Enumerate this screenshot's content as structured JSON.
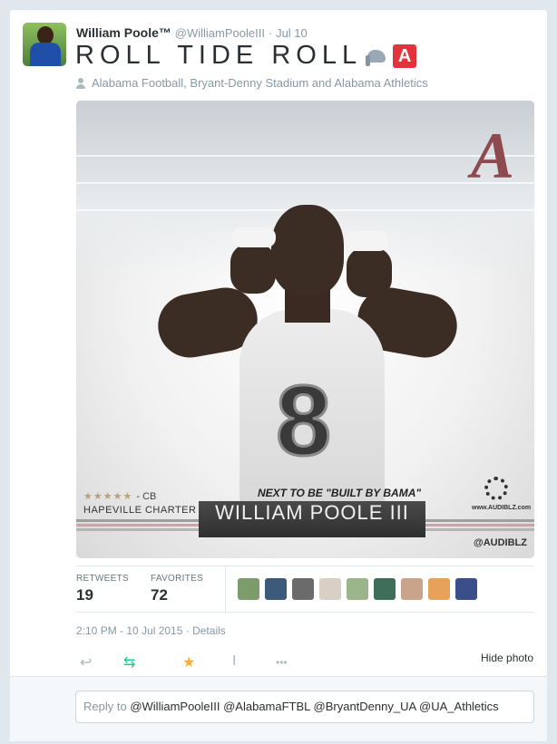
{
  "tweet": {
    "author_name": "William Poole™",
    "handle": "@WilliamPooleIII",
    "separator": "·",
    "time": "Jul 10",
    "text": "ROLL TIDE ROLL",
    "emoji_icons": [
      "elephant-icon",
      "letter-a-icon"
    ],
    "emoji_a_letter": "A",
    "place": "Alabama Football, Bryant-Denny Stadium and Alabama Athletics"
  },
  "photo": {
    "logo_letter": "A",
    "jersey_number": "8",
    "stars": "★★★★★",
    "position": "- CB",
    "school": "HAPEVILLE CHARTER",
    "tagline": "NEXT TO BE \"BUILT BY BAMA\"",
    "banner_name": "WILLIAM POOLE III",
    "site": "www.AUDIBLZ.com",
    "watermark": "@AUDIBLZ",
    "colors": {
      "crimson": "#8e4b4f",
      "stripe_1": "#9e9e9e",
      "stripe_2": "#c9a5a5",
      "stripe_3": "#b5b5b5"
    }
  },
  "stats": {
    "retweets_label": "RETWEETS",
    "retweets_value": "19",
    "favorites_label": "FAVORITES",
    "favorites_value": "72",
    "favoriter_avatars": [
      "#7d9c6b",
      "#3c5a7a",
      "#6b6b6b",
      "#d9cfc4",
      "#9ab58a",
      "#3f6e5a",
      "#c9a48a",
      "#e6a15a",
      "#3a4f8a"
    ]
  },
  "meta": {
    "timestamp": "2:10 PM - 10 Jul 2015",
    "separator": "·",
    "details_label": "Details"
  },
  "actions": {
    "icons": [
      "reply-icon",
      "retweet-icon",
      "favorite-icon",
      "text-cursor-icon",
      "more-icon"
    ],
    "reply_glyph": "↩",
    "retweet_glyph": "⇆",
    "favorite_glyph": "★",
    "cursor_glyph": "I",
    "more_glyph": "•••",
    "hide_photo_label": "Hide photo",
    "colors": {
      "retweet": "#19cf86",
      "favorite": "#ffac33"
    }
  },
  "reply": {
    "prefix": "Reply to",
    "mentions": "@WilliamPooleIII @AlabamaFTBL @BryantDenny_UA @UA_Athletics"
  }
}
